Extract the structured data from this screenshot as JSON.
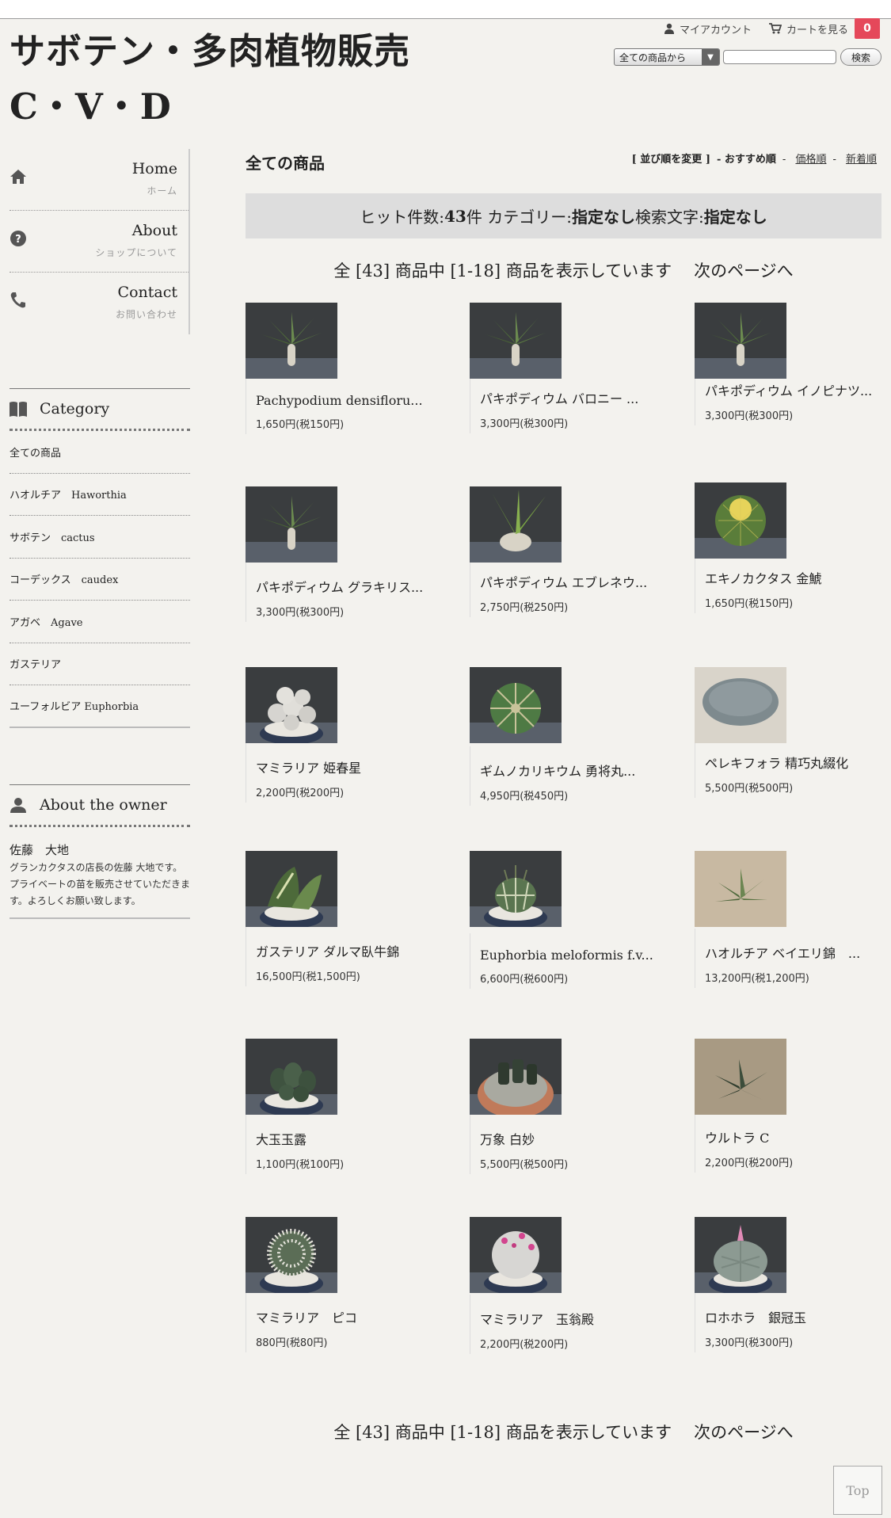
{
  "site": {
    "title_line1": "サボテン・多肉植物販売",
    "title_line2": "C・V・D"
  },
  "header": {
    "account": "マイアカウント",
    "cart": "カートを見る",
    "cart_count": "0"
  },
  "search": {
    "select_value": "全ての商品から",
    "button": "検索"
  },
  "nav": [
    {
      "en": "Home",
      "jp": "ホーム",
      "icon": "home-icon"
    },
    {
      "en": "About",
      "jp": "ショップについて",
      "icon": "question-icon"
    },
    {
      "en": "Contact",
      "jp": "お問い合わせ",
      "icon": "phone-icon"
    }
  ],
  "category": {
    "title": "Category",
    "items": [
      "全ての商品",
      "ハオルチア　Haworthia",
      "サボテン　cactus",
      "コーデックス　caudex",
      "アガベ　Agave",
      "ガステリア",
      "ユーフォルビア Euphorbia"
    ]
  },
  "owner": {
    "title": "About the owner",
    "name": "佐藤　大地",
    "desc": "グランカクタスの店長の佐藤 大地です。プライベートの苗を販売させていただきます。よろしくお願い致します。"
  },
  "main": {
    "title": "全ての商品",
    "sort_label": "[ 並び順を変更 ]",
    "sort_recommended": "- おすすめ順",
    "sort_price": "価格順",
    "sort_new": "新着順",
    "hit_prefix": "ヒット件数: ",
    "hit_count": "43",
    "hit_unit": "件 カテゴリー: ",
    "hit_category": "指定なし",
    "hit_search_label": " 検索文字: ",
    "hit_search": "指定なし",
    "pager_text": "全 [43] 商品中 [1-18] 商品を表示しています",
    "pager_next": "次のページへ"
  },
  "products": [
    {
      "name": "Pachypodium densifloru...",
      "price": "1,650円(税150円)",
      "plant": "pachy"
    },
    {
      "name": "パキポディウム バロニー ...",
      "price": "3,300円(税300円)",
      "plant": "pachy"
    },
    {
      "name": "パキポディウム イノピナツ...",
      "price": "3,300円(税300円)",
      "plant": "pachy"
    },
    {
      "name": "パキポディウム グラキリス...",
      "price": "3,300円(税300円)",
      "plant": "pachy"
    },
    {
      "name": "パキポディウム エブレネウ...",
      "price": "2,750円(税250円)",
      "plant": "pachy2"
    },
    {
      "name": "エキノカクタス 金鯱",
      "price": "1,650円(税150円)",
      "plant": "barrel"
    },
    {
      "name": "マミラリア 姫春星",
      "price": "2,200円(税200円)",
      "plant": "cluster"
    },
    {
      "name": "ギムノカリキウム 勇将丸...",
      "price": "4,950円(税450円)",
      "plant": "globe"
    },
    {
      "name": "ペレキフォラ 精巧丸綴化",
      "price": "5,500円(税500円)",
      "plant": "crest"
    },
    {
      "name": "ガステリア ダルマ臥牛錦",
      "price": "16,500円(税1,500円)",
      "plant": "gasteria"
    },
    {
      "name": "Euphorbia meloformis f.v...",
      "price": "6,600円(税600円)",
      "plant": "euph"
    },
    {
      "name": "ハオルチア ベイエリ錦　...",
      "price": "13,200円(税1,200円)",
      "plant": "haworthia"
    },
    {
      "name": "大玉玉露",
      "price": "1,100円(税100円)",
      "plant": "obtusa"
    },
    {
      "name": "万象 白妙",
      "price": "5,500円(税500円)",
      "plant": "truncata"
    },
    {
      "name": "ウルトラ C",
      "price": "2,200円(税200円)",
      "plant": "haworthia2"
    },
    {
      "name": "マミラリア　ピコ",
      "price": "880円(税80円)",
      "plant": "spiny"
    },
    {
      "name": "マミラリア　玉翁殿",
      "price": "2,200円(税200円)",
      "plant": "mammpink"
    },
    {
      "name": "ロホホラ　銀冠玉",
      "price": "3,300円(税300円)",
      "plant": "lophophora"
    }
  ],
  "top_button": "Top"
}
